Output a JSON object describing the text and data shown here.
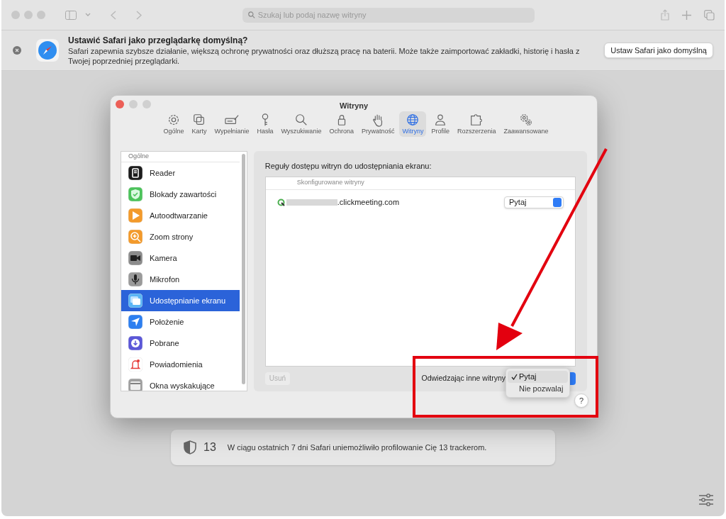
{
  "browser": {
    "search_placeholder": "Szukaj lub podaj nazwę witryny"
  },
  "banner": {
    "title": "Ustawić Safari jako przeglądarkę domyślną?",
    "text": "Safari zapewnia szybsze działanie, większą ochronę prywatności oraz dłuższą pracę na baterii. Może także zaimportować zakładki, historię i hasła z Twojej poprzedniej przeglądarki.",
    "button": "Ustaw Safari jako domyślną"
  },
  "privacy_report": {
    "count": "13",
    "text": "W ciągu ostatnich 7 dni Safari uniemożliwiło profilowanie Cię 13 trackerom."
  },
  "preferences": {
    "title": "Witryny",
    "tabs": [
      {
        "label": "Ogólne",
        "selected": false
      },
      {
        "label": "Karty",
        "selected": false
      },
      {
        "label": "Wypełnianie",
        "selected": false
      },
      {
        "label": "Hasła",
        "selected": false
      },
      {
        "label": "Wyszukiwanie",
        "selected": false
      },
      {
        "label": "Ochrona",
        "selected": false
      },
      {
        "label": "Prywatność",
        "selected": false
      },
      {
        "label": "Witryny",
        "selected": true
      },
      {
        "label": "Profile",
        "selected": false
      },
      {
        "label": "Rozszerzenia",
        "selected": false
      },
      {
        "label": "Zaawansowane",
        "selected": false
      }
    ],
    "sidebar": {
      "section": "Ogólne",
      "items": [
        {
          "label": "Reader",
          "selected": false
        },
        {
          "label": "Blokady zawartości",
          "selected": false
        },
        {
          "label": "Autoodtwarzanie",
          "selected": false
        },
        {
          "label": "Zoom strony",
          "selected": false
        },
        {
          "label": "Kamera",
          "selected": false
        },
        {
          "label": "Mikrofon",
          "selected": false
        },
        {
          "label": "Udostępnianie ekranu",
          "selected": true
        },
        {
          "label": "Położenie",
          "selected": false
        },
        {
          "label": "Pobrane",
          "selected": false
        },
        {
          "label": "Powiadomienia",
          "selected": false
        },
        {
          "label": "Okna wyskakujące",
          "selected": false
        }
      ]
    },
    "panel": {
      "heading": "Reguły dostępu witryn do udostępniania ekranu:",
      "column": "Skonfigurowane witryny",
      "rows": [
        {
          "site": ".clickmeeting.com",
          "setting": "Pytaj"
        }
      ],
      "remove_button": {
        "label": "Usuń",
        "disabled": true
      },
      "other_sites_label": "Odwiedzając inne witryny",
      "menu": [
        {
          "label": "Pytaj",
          "selected": true
        },
        {
          "label": "Nie pozwalaj",
          "selected": false
        }
      ],
      "help": "?"
    }
  }
}
